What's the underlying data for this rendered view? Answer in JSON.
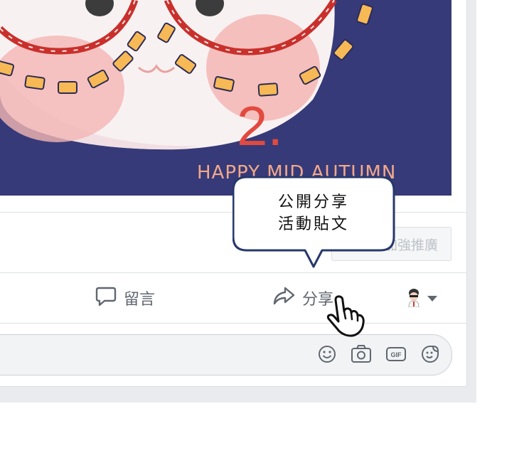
{
  "post": {
    "image_caption": "HAPPY MID AUTUMN",
    "step_number": "2.",
    "boost_label": "加強推廣"
  },
  "tooltip": {
    "line1": "公開分享",
    "line2": "活動貼文"
  },
  "actions": {
    "comment_label": "留言",
    "share_label": "分享"
  },
  "comment_box": {
    "icons": [
      "smiley-icon",
      "camera-icon",
      "gif-icon",
      "sticker-icon"
    ]
  },
  "colors": {
    "image_background": "#363a78",
    "step_number": "#e24a3f",
    "caption": "#f2a88a",
    "dash_accent": "#f7b955",
    "tooltip_border": "#27386b"
  }
}
